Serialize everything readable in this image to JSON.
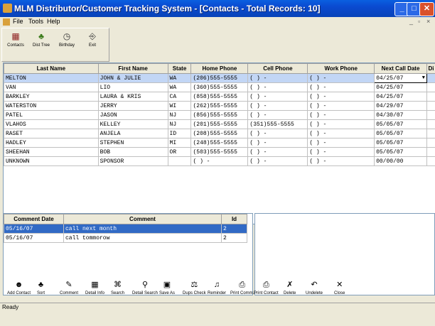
{
  "window": {
    "title": "MLM Distributor/Customer Tracking System - [Contacts - Total Records: 10]"
  },
  "menu": [
    "File",
    "Tools",
    "Help"
  ],
  "top_toolbar": [
    {
      "label": "Contacts",
      "icon": "contacts-icon"
    },
    {
      "label": "Dist Tree",
      "icon": "tree-icon"
    },
    {
      "label": "Birthday",
      "icon": "clock-icon"
    },
    {
      "label": "Exit",
      "icon": "exit-icon"
    }
  ],
  "contacts": {
    "columns": [
      "Last Name",
      "First Name",
      "State",
      "Home Phone",
      "Cell Phone",
      "Work Phone",
      "Next Call Date",
      "Di"
    ],
    "rows": [
      [
        "MELTON",
        "JOHN & JULIE",
        "WA",
        "(206)555-5555",
        "(   )   -",
        "(   )   -",
        "04/25/07",
        ""
      ],
      [
        "VAN",
        "LIO",
        "WA",
        "(360)555-5555",
        "(   )   -",
        "(   )   -",
        "04/25/07",
        ""
      ],
      [
        "BARKLEY",
        "LAURA & KRIS",
        "CA",
        "(858)555-5555",
        "(   )   -",
        "(   )   -",
        "04/25/07",
        ""
      ],
      [
        "WATERSTON",
        "JERRY",
        "WI",
        "(262)555-5555",
        "(   )   -",
        "(   )   -",
        "04/29/07",
        ""
      ],
      [
        "PATEL",
        "JASON",
        "NJ",
        "(856)555-5555",
        "(   )   -",
        "(   )   -",
        "04/30/07",
        ""
      ],
      [
        "VLAHOS",
        "KELLEY",
        "NJ",
        "(201)555-5555",
        "(351)555-5555",
        "(   )   -",
        "05/05/07",
        ""
      ],
      [
        "RASET",
        "ANJELA",
        "ID",
        "(208)555-5555",
        "(   )   -",
        "(   )   -",
        "05/05/07",
        ""
      ],
      [
        "HADLEY",
        "STEPHEN",
        "MI",
        "(248)555-5555",
        "(   )   -",
        "(   )   -",
        "05/05/07",
        ""
      ],
      [
        "SHEEHAN",
        "BOB",
        "OR",
        "(503)555-5555",
        "(   )   -",
        "(   )   -",
        "05/05/07",
        ""
      ],
      [
        "UNKNOWN",
        "SPONSOR",
        "",
        "(   )   -",
        "(   )   -",
        "(   )   -",
        "00/00/00",
        ""
      ]
    ]
  },
  "comments": {
    "columns": [
      "Comment Date",
      "Comment",
      "Id"
    ],
    "rows": [
      [
        "05/16/07",
        "call next month",
        "2"
      ],
      [
        "05/16/07",
        "call tommorow",
        "2"
      ]
    ]
  },
  "bottom_toolbar": [
    {
      "label": "Add Contact",
      "icon": "add-contact-icon"
    },
    {
      "label": "Sort",
      "icon": "sort-icon"
    },
    {
      "label": "Comment",
      "icon": "comment-icon"
    },
    {
      "label": "Detail Info",
      "icon": "detail-info-icon"
    },
    {
      "label": "Search",
      "icon": "binoculars-icon"
    },
    {
      "label": "Detail Search",
      "icon": "detail-search-icon"
    },
    {
      "label": "Save As",
      "icon": "save-icon"
    },
    {
      "label": "Dups Check",
      "icon": "dups-check-icon"
    },
    {
      "label": "Reminder",
      "icon": "bell-icon"
    },
    {
      "label": "Print Comm.",
      "icon": "print-icon"
    },
    {
      "label": "Print Contact",
      "icon": "print-icon"
    },
    {
      "label": "Delete",
      "icon": "delete-icon"
    },
    {
      "label": "Undelete",
      "icon": "undo-icon"
    },
    {
      "label": "Close",
      "icon": "close-icon"
    }
  ],
  "status": "Ready",
  "colors": {
    "titlebar": "#0a4ad0",
    "selected_row": "#c2d6f5",
    "comment_selected": "#316ac5"
  }
}
